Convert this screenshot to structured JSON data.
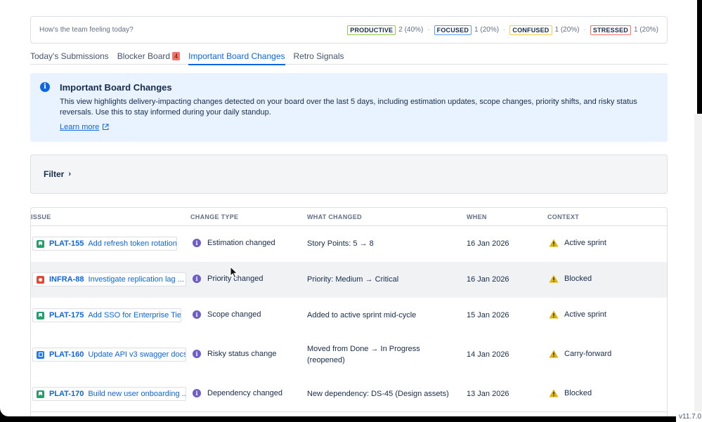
{
  "mood": {
    "question": "How's the team feeling today?",
    "items": [
      {
        "label": "PRODUCTIVE",
        "stat": "2 (40%)",
        "color": "#94c748"
      },
      {
        "label": "FOCUSED",
        "stat": "1 (20%)",
        "color": "#579dff"
      },
      {
        "label": "CONFUSED",
        "stat": "1 (20%)",
        "color": "#f5cd47"
      },
      {
        "label": "STRESSED",
        "stat": "1 (20%)",
        "color": "#f87168"
      }
    ],
    "separator": "·"
  },
  "tabs": [
    {
      "label": "Today's Submissions",
      "badge": ""
    },
    {
      "label": "Blocker Board",
      "badge": "4"
    },
    {
      "label": "Important Board Changes",
      "badge": "",
      "active": true
    },
    {
      "label": "Retro Signals",
      "badge": ""
    }
  ],
  "info": {
    "icon": "info-icon",
    "title": "Important Board Changes",
    "body": "This view highlights delivery-impacting changes detected on your board over the last 5 days, including estimation updates, scope changes, priority shifts, and risky status reversals. Use this to stay informed during your daily standup.",
    "link": "Learn more"
  },
  "filter": {
    "label": "Filter",
    "chevron": "›"
  },
  "table": {
    "headers": {
      "issue": "ISSUE",
      "change_type": "CHANGE TYPE",
      "what_changed": "WHAT CHANGED",
      "when": "WHEN",
      "context": "CONTEXT"
    },
    "rows": [
      {
        "type": "story",
        "key": "PLAT-155",
        "summary": "Add refresh token rotation",
        "change_type": "Estimation changed",
        "what": "Story Points: 5 → 8",
        "when": "16 Jan 2026",
        "context": "Active sprint"
      },
      {
        "type": "bug",
        "key": "INFRA-88",
        "summary": "Investigate replication lag ...",
        "change_type": "Priority changed",
        "what": "Priority: Medium → Critical",
        "when": "16 Jan 2026",
        "context": "Blocked"
      },
      {
        "type": "story",
        "key": "PLAT-175",
        "summary": "Add SSO for Enterprise Tier",
        "change_type": "Scope changed",
        "what": "Added to active sprint mid-cycle",
        "when": "15 Jan 2026",
        "context": "Active sprint"
      },
      {
        "type": "task",
        "key": "PLAT-160",
        "summary": "Update API v3 swagger docs",
        "change_type": "Risky status change",
        "what": "Moved from Done → In Progress",
        "what2": "(reopened)",
        "when": "14 Jan 2026",
        "context": "Carry-forward"
      },
      {
        "type": "story",
        "key": "PLAT-170",
        "summary": "Build new user onboarding ...",
        "change_type": "Dependency changed",
        "what": "New dependency: DS-45 (Design assets)",
        "when": "13 Jan 2026",
        "context": "Blocked"
      }
    ]
  },
  "version": "v11.7.0",
  "colors": {
    "accent": "#0c66e4",
    "info_bg": "#e9f2ff",
    "warning": "#e2b203",
    "change_icon": "#6e5dc6"
  }
}
